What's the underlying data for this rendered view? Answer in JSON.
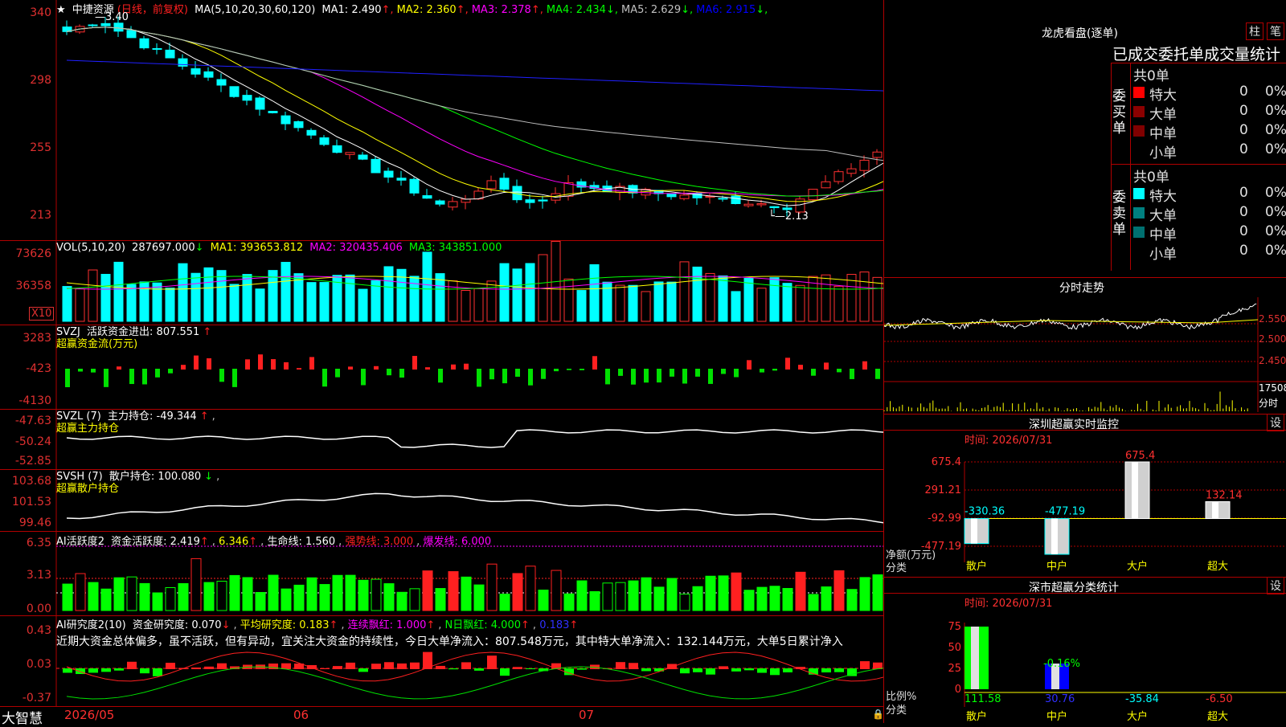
{
  "stock": {
    "name": "中捷资源",
    "mode": "(日线，前复权)",
    "ma_label": "MA(5,10,20,30,60,120)",
    "ma": [
      {
        "label": "MA1:",
        "value": "2.490",
        "arrow": "↑",
        "color": "#ffffff"
      },
      {
        "label": "MA2:",
        "value": "2.360",
        "arrow": "↑",
        "color": "#ffff00"
      },
      {
        "label": "MA3:",
        "value": "2.378",
        "arrow": "↑",
        "color": "#ff00ff"
      },
      {
        "label": "MA4:",
        "value": "2.434",
        "arrow": "↓",
        "color": "#00ff00"
      },
      {
        "label": "MA5:",
        "value": "2.629",
        "arrow": "↓",
        "color": "#c0c0c0"
      },
      {
        "label": "MA6:",
        "value": "2.915",
        "arrow": "↓",
        "color": "#0000ff"
      }
    ],
    "high_label": "3.40",
    "low_label": "2.13",
    "price_axis": [
      "340",
      "298",
      "255",
      "213"
    ]
  },
  "vol": {
    "label": "VOL(5,10,20)",
    "value": "287697.000",
    "arrow": "↓",
    "ma1": "MA1: 393653.812",
    "ma2": "MA2: 320435.406",
    "ma3": "MA3: 343851.000",
    "axis": [
      "73626",
      "36358"
    ],
    "unit": "X10"
  },
  "svzj": {
    "label": "SVZJ",
    "desc": "活跃资金进出: 807.551",
    "sub": "超赢资金流(万元)",
    "axis": [
      "3283",
      "-423",
      "-4130"
    ]
  },
  "svzl": {
    "label": "SVZL (7)",
    "desc": "主力持仓: -49.344",
    "sub": "超赢主力持仓",
    "axis": [
      "-47.63",
      "-50.24",
      "-52.85"
    ]
  },
  "svsh": {
    "label": "SVSH (7)",
    "desc": "散户持仓: 100.080",
    "sub": "超赢散户持仓",
    "axis": [
      "103.68",
      "101.53",
      "99.46"
    ]
  },
  "ai1": {
    "label": "AI活跃度2",
    "desc": "资金活跃度: 2.419",
    "v2": "6.346",
    "life": "生命线: 1.560",
    "strong": "强势线: 3.000",
    "burst": "爆发线: 6.000",
    "axis": [
      "6.35",
      "3.13",
      "0.00"
    ]
  },
  "ai2": {
    "label": "AI研究度2(10)",
    "research": "资金研究度: 0.070",
    "avg": "平均研究度: 0.183",
    "cont": "连续飘红: 1.000",
    "nday": "N日飘红: 4.000",
    "last": "0.183",
    "comment": "近期大资金总体偏多，虽不活跃，但有异动，宜关注大资金的持续性，今日大单净流入：807.548万元，其中特大单净流入：132.144万元，大单5日累计净入",
    "axis": [
      "0.43",
      "0.03",
      "-0.37"
    ]
  },
  "bottom": {
    "logo": "大智慧",
    "dates": [
      "2026/05",
      "06",
      "07"
    ]
  },
  "lhb": {
    "title": "龙虎看盘(逐单)",
    "btn1": "柱",
    "btn2": "笔",
    "heading": "已成交委托单成交量统计",
    "buy": {
      "side": "委买单",
      "total": "共0单",
      "rows": [
        {
          "name": "特大",
          "count": "0",
          "pct": "0%",
          "color": "#ff0000"
        },
        {
          "name": "大单",
          "count": "0",
          "pct": "0%",
          "color": "#8b0000"
        },
        {
          "name": "中单",
          "count": "0",
          "pct": "0%",
          "color": "#800000"
        },
        {
          "name": "小单",
          "count": "0",
          "pct": "0%",
          "color": "#000000"
        }
      ]
    },
    "sell": {
      "side": "委卖单",
      "total": "共0单",
      "rows": [
        {
          "name": "特大",
          "count": "0",
          "pct": "0%",
          "color": "#00ffff"
        },
        {
          "name": "大单",
          "count": "0",
          "pct": "0%",
          "color": "#008080"
        },
        {
          "name": "中单",
          "count": "0",
          "pct": "0%",
          "color": "#007070"
        },
        {
          "name": "小单",
          "count": "0",
          "pct": "0%",
          "color": "#000000"
        }
      ]
    }
  },
  "fenshi": {
    "title": "分时走势",
    "axis": [
      "2.550",
      "2.500",
      "2.450"
    ],
    "vol": "17508",
    "unit": "分时"
  },
  "monitor": {
    "title": "深圳超赢实时监控",
    "btn": "设",
    "time": "时间: 2026/07/31",
    "axis": [
      "675.4",
      "291.21",
      "-92.99",
      "-477.19"
    ],
    "ylabel": "净额(万元)",
    "xlabel": "分类",
    "cats": [
      "散户",
      "中户",
      "大户",
      "超大"
    ],
    "values": [
      "-330.36",
      "-477.19",
      "675.4",
      "132.14"
    ]
  },
  "classify": {
    "title": "深市超赢分类统计",
    "btn": "设",
    "time": "时间: 2026/07/31",
    "axis": [
      "75",
      "50",
      "25",
      "0"
    ],
    "ylabel": "比例%",
    "xlabel": "分类",
    "cats": [
      "散户",
      "中户",
      "大户",
      "超大"
    ],
    "values": [
      "111.58",
      "30.76",
      "-35.84",
      "-6.50"
    ],
    "mid_label": "-0.16%"
  }
}
